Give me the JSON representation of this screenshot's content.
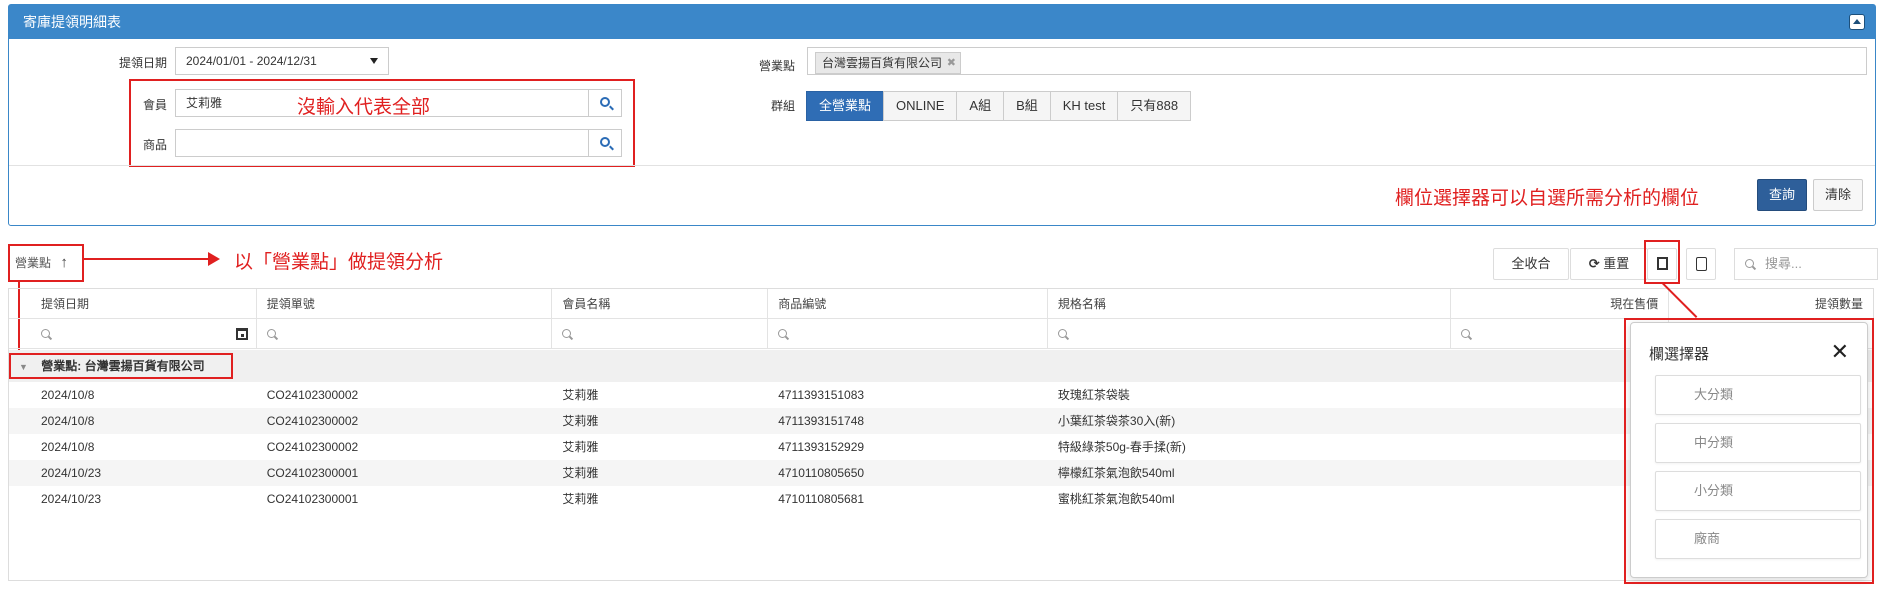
{
  "panel": {
    "title": "寄庫提領明細表",
    "date_label": "提領日期",
    "date_value": "2024/01/01 - 2024/12/31",
    "member_label": "會員",
    "member_value": "艾莉雅",
    "product_label": "商品",
    "product_value": "",
    "store_label": "營業點",
    "store_tag": "台灣雲揚百貨有限公司",
    "group_label": "群組",
    "groups": [
      "全營業點",
      "ONLINE",
      "A組",
      "B組",
      "KH test",
      "只有888"
    ],
    "query_button": "查詢",
    "clear_button": "清除"
  },
  "annotations": {
    "no_input": "沒輸入代表全部",
    "column_picker_note": "欄位選擇器可以自選所需分析的欄位",
    "group_by_note": "以「營業點」做提領分析"
  },
  "toolbar": {
    "grouping_chip": "營業點",
    "collapse_all": "全收合",
    "reset": "重置",
    "search_placeholder": "搜尋..."
  },
  "grid": {
    "columns": [
      "提領日期",
      "提領單號",
      "會員名稱",
      "商品編號",
      "規格名稱",
      "現在售價",
      "提領數量"
    ],
    "group_row": "營業點: 台灣雲揚百貨有限公司",
    "rows": [
      [
        "2024/10/8",
        "CO24102300002",
        "艾莉雅",
        "4711393151083",
        "玫瑰紅茶袋裝"
      ],
      [
        "2024/10/8",
        "CO24102300002",
        "艾莉雅",
        "4711393151748",
        "小葉紅茶袋茶30入(新)"
      ],
      [
        "2024/10/8",
        "CO24102300002",
        "艾莉雅",
        "4711393152929",
        "特級綠茶50g-春手揉(新)"
      ],
      [
        "2024/10/23",
        "CO24102300001",
        "艾莉雅",
        "4710110805650",
        "檸檬紅茶氣泡飲540ml"
      ],
      [
        "2024/10/23",
        "CO24102300001",
        "艾莉雅",
        "4710110805681",
        "蜜桃紅茶氣泡飲540ml"
      ]
    ]
  },
  "picker": {
    "title": "欄選擇器",
    "items": [
      "大分類",
      "中分類",
      "小分類",
      "廠商"
    ]
  },
  "colors": {
    "header_blue": "#3b87c9",
    "active_blue": "#2f6db5",
    "annotation_red": "#e02020"
  }
}
